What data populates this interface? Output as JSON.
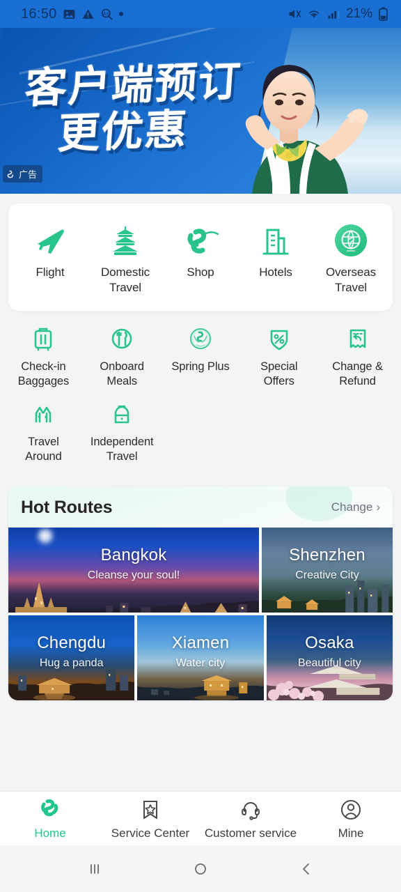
{
  "status_bar": {
    "time": "16:50",
    "battery_percent": "21%",
    "left_icons": [
      "image-icon",
      "warning-triangle-icon",
      "magnifier-text-icon",
      "dot-indicator"
    ],
    "right_icons": [
      "mute-icon",
      "wifi-icon",
      "signal-bars-icon",
      "battery-icon"
    ]
  },
  "banner": {
    "line1": "客户端预订",
    "line2": "更优惠",
    "ad_label": "广告",
    "accent_blue": "#1569cf"
  },
  "quick_actions": {
    "primary": [
      {
        "label": "Flight",
        "icon": "airplane-icon"
      },
      {
        "label": "Domestic Travel",
        "icon": "pagoda-icon"
      },
      {
        "label": "Shop",
        "icon": "spring-swirl-icon"
      },
      {
        "label": "Hotels",
        "icon": "building-icon"
      },
      {
        "label": "Overseas Travel",
        "icon": "globe-icon"
      }
    ],
    "secondary": [
      {
        "label": "Check-in Baggages",
        "icon": "suitcase-icon"
      },
      {
        "label": "Onboard Meals",
        "icon": "cutlery-circle-icon"
      },
      {
        "label": "Spring Plus",
        "icon": "spring-seal-icon"
      },
      {
        "label": "Special Offers",
        "icon": "percent-tag-icon"
      },
      {
        "label": "Change & Refund",
        "icon": "receipt-return-icon"
      },
      {
        "label": "Travel Around",
        "icon": "temple-icon"
      },
      {
        "label": "Independent Travel",
        "icon": "backpack-icon"
      }
    ]
  },
  "hot_routes": {
    "title": "Hot Routes",
    "change_label": "Change",
    "chevron": "›",
    "destinations": [
      {
        "name": "Bangkok",
        "tagline": "Cleanse your soul!"
      },
      {
        "name": "Shenzhen",
        "tagline": "Creative City"
      },
      {
        "name": "Chengdu",
        "tagline": "Hug a panda"
      },
      {
        "name": "Xiamen",
        "tagline": "Water city"
      },
      {
        "name": "Osaka",
        "tagline": "Beautiful city"
      }
    ]
  },
  "bottom_nav": {
    "active_color": "#22c58a",
    "items": [
      {
        "label": "Home",
        "icon": "spring-swirl-icon",
        "active": true
      },
      {
        "label": "Service Center",
        "icon": "bookmark-star-icon",
        "active": false
      },
      {
        "label": "Customer service",
        "icon": "headset-icon",
        "active": false
      },
      {
        "label": "Mine",
        "icon": "user-circle-icon",
        "active": false
      }
    ]
  },
  "system_nav": {
    "recents": "recents-icon",
    "home": "home-circle-icon",
    "back": "back-chevron-icon"
  },
  "theme": {
    "green": "#29c48c",
    "bg": "#f3f4f6"
  }
}
